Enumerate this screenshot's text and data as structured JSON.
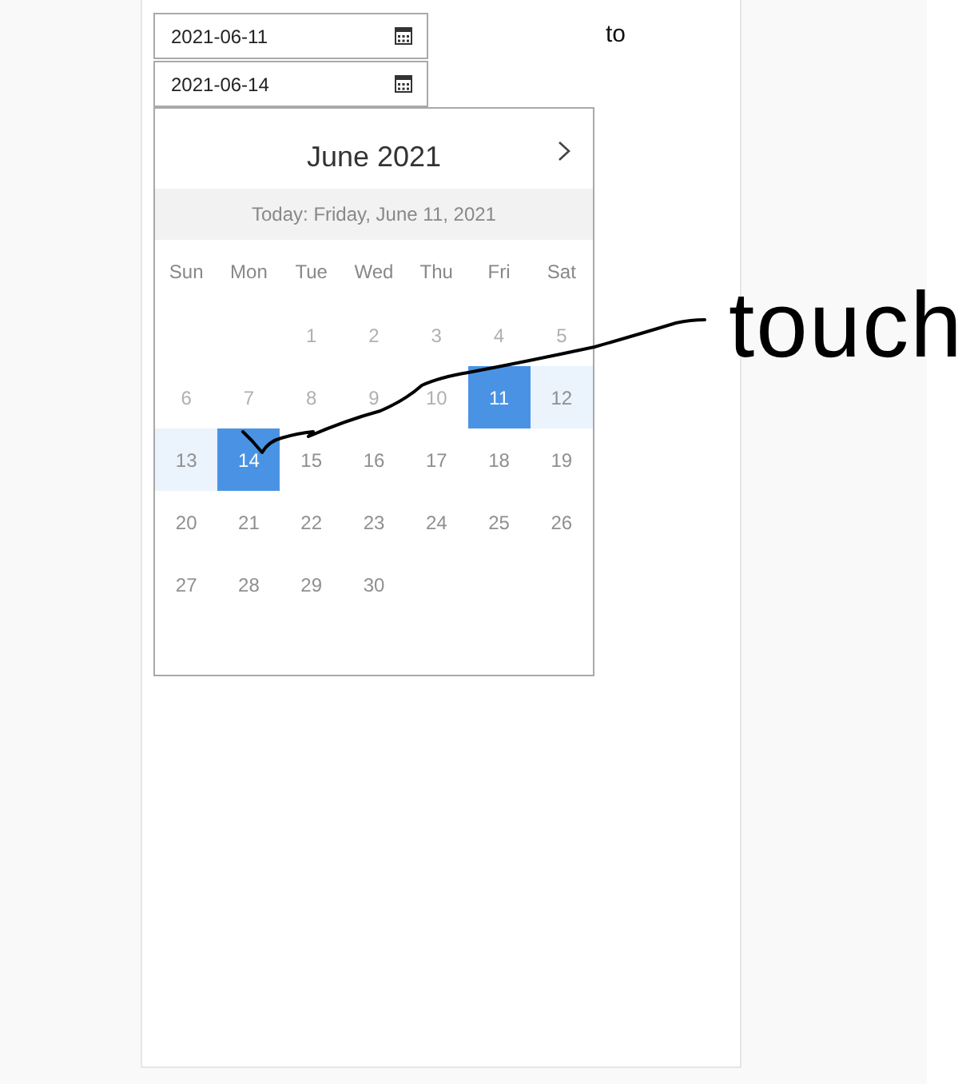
{
  "range": {
    "start": {
      "value": "2021-06-11"
    },
    "separator": "to",
    "end": {
      "value": "2021-06-14"
    }
  },
  "calendar": {
    "title": "June 2021",
    "today": "Today: Friday, June 11, 2021",
    "weekdays": [
      "Sun",
      "Mon",
      "Tue",
      "Wed",
      "Thu",
      "Fri",
      "Sat"
    ],
    "weeks": [
      [
        {
          "kind": "blank"
        },
        {
          "kind": "blank"
        },
        {
          "kind": "day",
          "label": "1",
          "disabled": true,
          "selected": false,
          "in_range": false
        },
        {
          "kind": "day",
          "label": "2",
          "disabled": true,
          "selected": false,
          "in_range": false
        },
        {
          "kind": "day",
          "label": "3",
          "disabled": true,
          "selected": false,
          "in_range": false
        },
        {
          "kind": "day",
          "label": "4",
          "disabled": true,
          "selected": false,
          "in_range": false
        },
        {
          "kind": "day",
          "label": "5",
          "disabled": true,
          "selected": false,
          "in_range": false
        }
      ],
      [
        {
          "kind": "day",
          "label": "6",
          "disabled": true,
          "selected": false,
          "in_range": false
        },
        {
          "kind": "day",
          "label": "7",
          "disabled": true,
          "selected": false,
          "in_range": false
        },
        {
          "kind": "day",
          "label": "8",
          "disabled": true,
          "selected": false,
          "in_range": false
        },
        {
          "kind": "day",
          "label": "9",
          "disabled": true,
          "selected": false,
          "in_range": false
        },
        {
          "kind": "day",
          "label": "10",
          "disabled": true,
          "selected": false,
          "in_range": false
        },
        {
          "kind": "day",
          "label": "11",
          "disabled": false,
          "selected": true,
          "in_range": false
        },
        {
          "kind": "day",
          "label": "12",
          "disabled": false,
          "selected": false,
          "in_range": true
        }
      ],
      [
        {
          "kind": "day",
          "label": "13",
          "disabled": false,
          "selected": false,
          "in_range": true
        },
        {
          "kind": "day",
          "label": "14",
          "disabled": false,
          "selected": true,
          "in_range": false
        },
        {
          "kind": "day",
          "label": "15",
          "disabled": false,
          "selected": false,
          "in_range": false
        },
        {
          "kind": "day",
          "label": "16",
          "disabled": false,
          "selected": false,
          "in_range": false
        },
        {
          "kind": "day",
          "label": "17",
          "disabled": false,
          "selected": false,
          "in_range": false
        },
        {
          "kind": "day",
          "label": "18",
          "disabled": false,
          "selected": false,
          "in_range": false
        },
        {
          "kind": "day",
          "label": "19",
          "disabled": false,
          "selected": false,
          "in_range": false
        }
      ],
      [
        {
          "kind": "day",
          "label": "20",
          "disabled": false,
          "selected": false,
          "in_range": false
        },
        {
          "kind": "day",
          "label": "21",
          "disabled": false,
          "selected": false,
          "in_range": false
        },
        {
          "kind": "day",
          "label": "22",
          "disabled": false,
          "selected": false,
          "in_range": false
        },
        {
          "kind": "day",
          "label": "23",
          "disabled": false,
          "selected": false,
          "in_range": false
        },
        {
          "kind": "day",
          "label": "24",
          "disabled": false,
          "selected": false,
          "in_range": false
        },
        {
          "kind": "day",
          "label": "25",
          "disabled": false,
          "selected": false,
          "in_range": false
        },
        {
          "kind": "day",
          "label": "26",
          "disabled": false,
          "selected": false,
          "in_range": false
        }
      ],
      [
        {
          "kind": "day",
          "label": "27",
          "disabled": false,
          "selected": false,
          "in_range": false
        },
        {
          "kind": "day",
          "label": "28",
          "disabled": false,
          "selected": false,
          "in_range": false
        },
        {
          "kind": "day",
          "label": "29",
          "disabled": false,
          "selected": false,
          "in_range": false
        },
        {
          "kind": "day",
          "label": "30",
          "disabled": false,
          "selected": false,
          "in_range": false
        }
      ]
    ]
  },
  "annotation": {
    "text": "touch"
  }
}
